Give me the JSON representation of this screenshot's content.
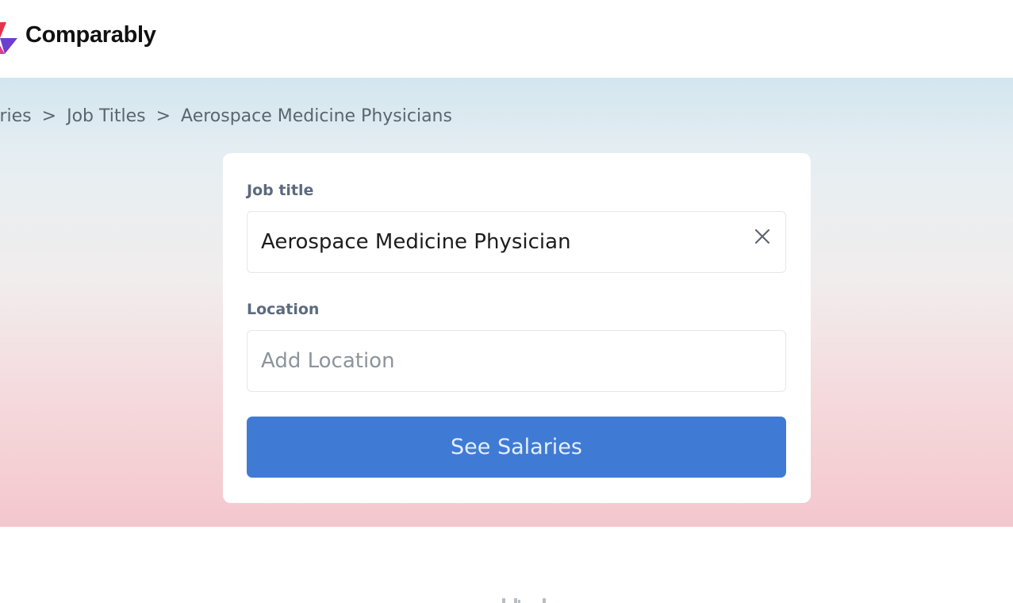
{
  "brand": {
    "name": "Comparably",
    "colors": {
      "mark_red": "#e6334a",
      "mark_purple": "#6b3fd1",
      "mark_magenta": "#d4408f"
    }
  },
  "breadcrumb": {
    "items": [
      "aries",
      "Job Titles",
      "Aerospace Medicine Physicians"
    ],
    "separator": ">"
  },
  "search_card": {
    "job_title_label": "Job title",
    "job_title_value": "Aerospace Medicine Physician",
    "clear_icon": "close-icon",
    "location_label": "Location",
    "location_placeholder": "Add Location",
    "submit_label": "See Salaries"
  },
  "colors": {
    "button": "#3f7bd5",
    "label": "#5c6a7e",
    "hero_top": "#d3e6ef",
    "hero_bottom": "#f3c7cd"
  }
}
